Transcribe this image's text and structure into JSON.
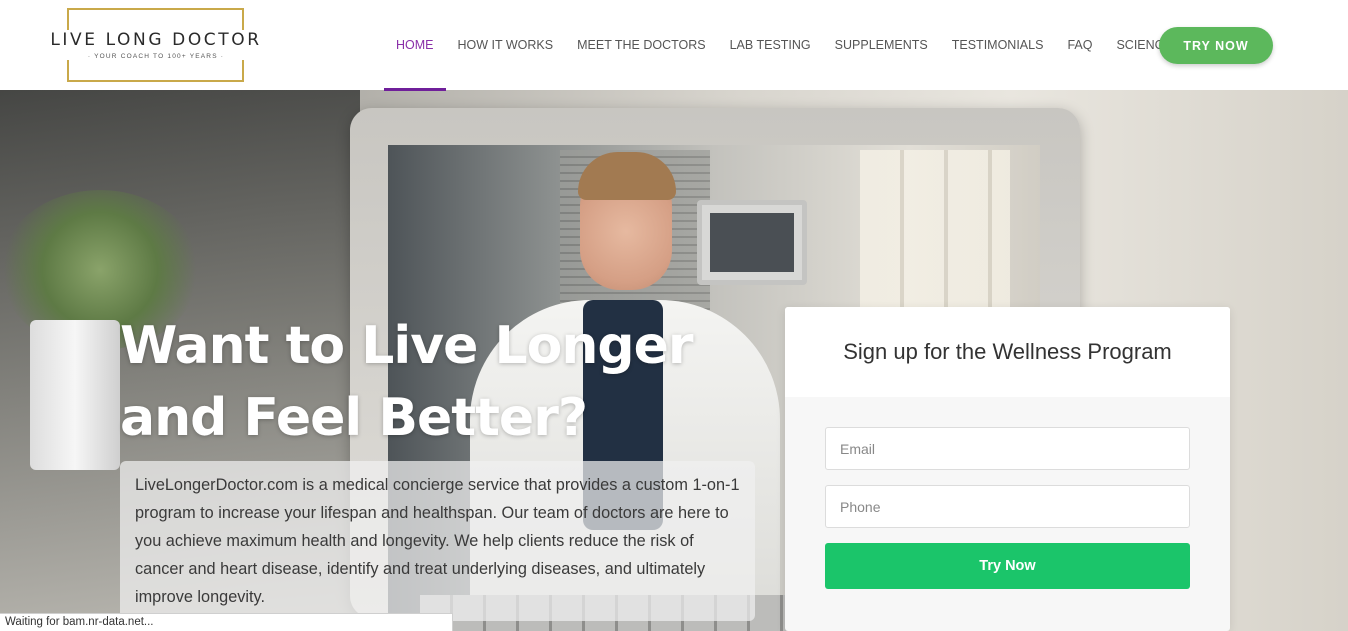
{
  "brand": {
    "title": "LIVE LONG DOCTOR",
    "tagline": "· YOUR COACH TO 100+ YEARS ·"
  },
  "nav": {
    "items": [
      {
        "label": "HOME",
        "active": true
      },
      {
        "label": "HOW IT WORKS"
      },
      {
        "label": "MEET THE DOCTORS"
      },
      {
        "label": "LAB TESTING"
      },
      {
        "label": "SUPPLEMENTS"
      },
      {
        "label": "TESTIMONIALS"
      },
      {
        "label": "FAQ"
      },
      {
        "label": "SCIENCE"
      }
    ],
    "cta_label": "TRY NOW"
  },
  "hero": {
    "headline_line1": "Want to Live Longer",
    "headline_line2": "and Feel Better?",
    "description": "LiveLongerDoctor.com is a medical concierge service that provides a custom 1-on-1 program to increase your lifespan and healthspan. Our team of doctors are here to you achieve maximum health and longevity. We help clients reduce the risk of cancer and heart disease, identify and treat underlying diseases, and ultimately improve longevity."
  },
  "signup": {
    "title": "Sign up for the Wellness Program",
    "email_placeholder": "Email",
    "phone_placeholder": "Phone",
    "submit_label": "Try Now"
  },
  "status_bar": {
    "text": "Waiting for bam.nr-data.net..."
  },
  "colors": {
    "accent_purple": "#8a2fa8",
    "cta_green": "#5cb85c",
    "submit_green": "#1bc56a",
    "logo_gold": "#c9a94a"
  }
}
